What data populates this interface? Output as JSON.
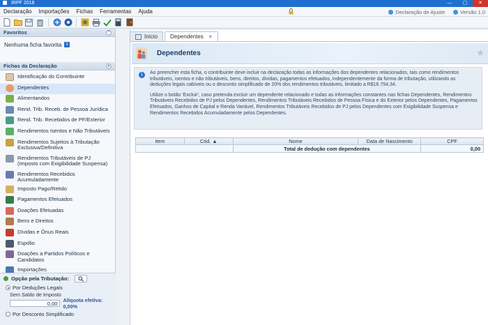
{
  "window": {
    "title": "IRPF 2018"
  },
  "menu": {
    "items": [
      "Declaração",
      "Importações",
      "Fichas",
      "Ferramentas",
      "Ajuda"
    ],
    "right": {
      "declaracao_ajuste": "Declaração de Ajuste",
      "versao": "Versão 1.0"
    }
  },
  "sidebar": {
    "favoritos_title": "Favoritos",
    "favoritos_empty": "Nenhuma ficha favorita",
    "fichas_title": "Fichas da Declaração",
    "fichas": [
      "Identificação do Contribuinte",
      "Dependentes",
      "Alimentandos",
      "Rend. Trib. Receb. de Pessoa Jurídica",
      "Rend. Trib. Recebidos de PF/Exterior",
      "Rendimentos Isentos e Não Tributáveis",
      "Rendimentos Sujeitos à Tributação Exclusiva/Definitiva",
      "Rendimentos Tributáveis de PJ (Imposto com Exigibilidade Suspensa)",
      "Rendimentos Recebidos Acumuladamente",
      "Imposto Pago/Retido",
      "Pagamentos Efetuados",
      "Doações Efetuadas",
      "Bens e Direitos",
      "Dívidas e Ônus Reais",
      "Espólio",
      "Doações a Partidos Políticos e Candidatos",
      "Importações"
    ],
    "opcao": {
      "title": "Opção pela Tributação:",
      "deducoes_legais": "Por Deduções Legais",
      "saldo_label": "Sem Saldo de Imposto",
      "saldo_value": "0,00",
      "aliquota": "Alíquota efetiva: 0,00%",
      "desconto_simplificado": "Por Desconto Simplificado"
    }
  },
  "tabs": [
    {
      "label": "Início"
    },
    {
      "label": "Dependentes"
    }
  ],
  "page": {
    "title": "Dependentes",
    "info_p1": "Ao preencher esta ficha, o contribuinte deve incluir na declaração todas as informações dos dependentes relacionados, tais como rendimentos tributáveis, isentos e não tributáveis, bens, direitos, dívidas, pagamentos efetuados, independentemente da forma de tributação, utilizando as deduções legais cabíveis ou o desconto simplificado de 20% dos rendimentos tributáveis, limitado a R$16.754,34.",
    "info_p2": "Utilize o botão 'Excluir', caso pretenda excluir um dependente relacionado e todas as informações constantes nas fichas Dependentes, Rendimentos Tributáveis Recebidos de PJ pelos Dependentes, Rendimentos Tributáveis Recebidos de Pessoa Física e do Exterior pelos Dependentes, Pagamentos Efetuados, Ganhos de Capital e Renda Variável, Rendimentos Tributáveis Recebidos de PJ pelos Dependentes com Exigibilidade Suspensa e Rendimentos Recebidos Acumuladamente pelos Dependentes."
  },
  "grid": {
    "headers": {
      "item": "Item",
      "cod": "Cód. ▲",
      "nome": "Nome",
      "nascimento": "Data de Nascimento",
      "cpf": "CPF"
    },
    "total_label": "Total de dedução com dependentes",
    "total_value": "0,00"
  },
  "colors": {
    "accent": "#1f6fd0",
    "selected": "#d8e8f8"
  }
}
